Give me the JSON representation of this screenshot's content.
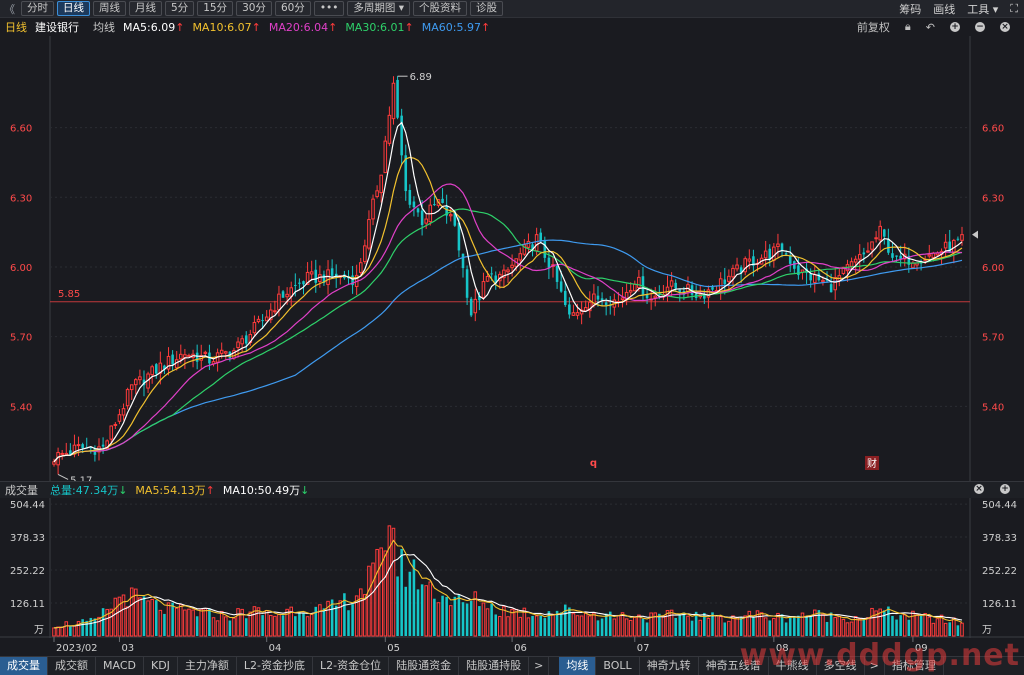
{
  "toolbar": {
    "back_icon": "double-chevron-left-icon",
    "tabs": [
      "分时",
      "日线",
      "周线",
      "月线",
      "5分",
      "15分",
      "30分",
      "60分",
      "•••",
      "多周期图 ▾",
      "个股资料",
      "诊股"
    ],
    "active_tab": 1,
    "right_items": [
      "筹码",
      "画线",
      "工具 ▾",
      "⛶"
    ]
  },
  "ma_bar": {
    "period": "日线",
    "stock_name": "建设银行",
    "type": "均线",
    "ma5": "MA5:6.09",
    "ma10": "MA10:6.07",
    "ma20": "MA20:6.04",
    "ma30": "MA30:6.01",
    "ma60": "MA60:5.97",
    "restore": "前复权",
    "colors": {
      "ma5": "#ffffff",
      "ma10": "#f2c12e",
      "ma20": "#e040c8",
      "ma30": "#2ed16a",
      "ma60": "#3f9bf0",
      "up": "#ff3b3b",
      "down": "#16c5c8",
      "bg": "#1a1b20"
    }
  },
  "price_axis": {
    "ticks": [
      "6.60",
      "6.30",
      "6.00",
      "5.70",
      "5.40"
    ],
    "tick_values": [
      6.6,
      6.3,
      6.0,
      5.7,
      5.4
    ],
    "min": 5.1,
    "max": 6.96
  },
  "annotations": {
    "high_label": "6.89",
    "low_label": "5.17",
    "ref_line_value": 5.85,
    "ref_line_label": "5.85",
    "event_marker_1": "q",
    "event_marker_2": "财"
  },
  "volume_header": {
    "title": "成交量",
    "total": "总量:47.34万",
    "ma5": "MA5:54.13万",
    "ma10": "MA10:50.49万"
  },
  "volume_axis": {
    "ticks": [
      "504.44",
      "378.33",
      "252.22",
      "126.11"
    ],
    "tick_values": [
      504.44,
      378.33,
      252.22,
      126.11
    ],
    "unit": "万",
    "max": 520
  },
  "x_axis": {
    "labels": [
      "2023/02",
      "03",
      "04",
      "05",
      "06",
      "07",
      "08",
      "09"
    ],
    "label_indices": [
      0,
      16,
      52,
      81,
      112,
      142,
      176,
      210
    ]
  },
  "bottom_tabs": [
    "成交量",
    "成交额",
    "MACD",
    "KDJ",
    "主力净额",
    "L2-资金抄底",
    "L2-资金仓位",
    "陆股通资金",
    "陆股通持股",
    ">",
    "均线",
    "BOLL",
    "神奇九转",
    "神奇五线谱",
    "牛熊线",
    "多空线",
    ">",
    "指标管理"
  ],
  "active_bottom_tab": 0,
  "active_indicator_tab": 10,
  "watermark": "www.dddgp.net",
  "chart_data": {
    "type": "candlestick",
    "title": "建设银行",
    "x_labels": [
      "2023/02",
      "03",
      "04",
      "05",
      "06",
      "07",
      "08",
      "09"
    ],
    "ohlc_anchors": [
      [
        0,
        5.18
      ],
      [
        6,
        5.22
      ],
      [
        12,
        5.22
      ],
      [
        19,
        5.48
      ],
      [
        26,
        5.57
      ],
      [
        32,
        5.63
      ],
      [
        38,
        5.6
      ],
      [
        44,
        5.64
      ],
      [
        50,
        5.75
      ],
      [
        56,
        5.88
      ],
      [
        62,
        5.95
      ],
      [
        68,
        5.96
      ],
      [
        74,
        5.95
      ],
      [
        80,
        6.42
      ],
      [
        83,
        6.78
      ],
      [
        86,
        6.32
      ],
      [
        90,
        6.2
      ],
      [
        94,
        6.28
      ],
      [
        98,
        6.18
      ],
      [
        102,
        5.8
      ],
      [
        106,
        5.95
      ],
      [
        110,
        5.96
      ],
      [
        114,
        6.05
      ],
      [
        118,
        6.12
      ],
      [
        122,
        5.98
      ],
      [
        126,
        5.78
      ],
      [
        130,
        5.85
      ],
      [
        134,
        5.87
      ],
      [
        138,
        5.85
      ],
      [
        142,
        5.95
      ],
      [
        146,
        5.86
      ],
      [
        150,
        5.92
      ],
      [
        154,
        5.9
      ],
      [
        158,
        5.88
      ],
      [
        162,
        5.92
      ],
      [
        166,
        5.97
      ],
      [
        170,
        6.02
      ],
      [
        174,
        6.05
      ],
      [
        178,
        6.08
      ],
      [
        182,
        5.98
      ],
      [
        186,
        5.95
      ],
      [
        190,
        5.92
      ],
      [
        194,
        5.99
      ],
      [
        198,
        6.05
      ],
      [
        202,
        6.15
      ],
      [
        206,
        6.02
      ],
      [
        210,
        6.04
      ],
      [
        214,
        6.05
      ],
      [
        218,
        6.08
      ],
      [
        222,
        6.11
      ]
    ],
    "volume_anchors": [
      [
        0,
        42
      ],
      [
        10,
        55
      ],
      [
        17,
        160
      ],
      [
        22,
        130
      ],
      [
        28,
        100
      ],
      [
        35,
        90
      ],
      [
        42,
        75
      ],
      [
        48,
        95
      ],
      [
        54,
        80
      ],
      [
        60,
        110
      ],
      [
        66,
        95
      ],
      [
        72,
        140
      ],
      [
        76,
        190
      ],
      [
        80,
        280
      ],
      [
        82,
        500
      ],
      [
        84,
        270
      ],
      [
        88,
        240
      ],
      [
        92,
        180
      ],
      [
        96,
        150
      ],
      [
        100,
        120
      ],
      [
        104,
        140
      ],
      [
        108,
        100
      ],
      [
        112,
        95
      ],
      [
        118,
        85
      ],
      [
        124,
        100
      ],
      [
        130,
        85
      ],
      [
        136,
        80
      ],
      [
        142,
        75
      ],
      [
        148,
        70
      ],
      [
        154,
        85
      ],
      [
        160,
        70
      ],
      [
        166,
        75
      ],
      [
        172,
        80
      ],
      [
        178,
        70
      ],
      [
        184,
        85
      ],
      [
        190,
        75
      ],
      [
        196,
        70
      ],
      [
        202,
        95
      ],
      [
        206,
        80
      ],
      [
        212,
        70
      ],
      [
        218,
        60
      ],
      [
        222,
        47
      ]
    ]
  }
}
